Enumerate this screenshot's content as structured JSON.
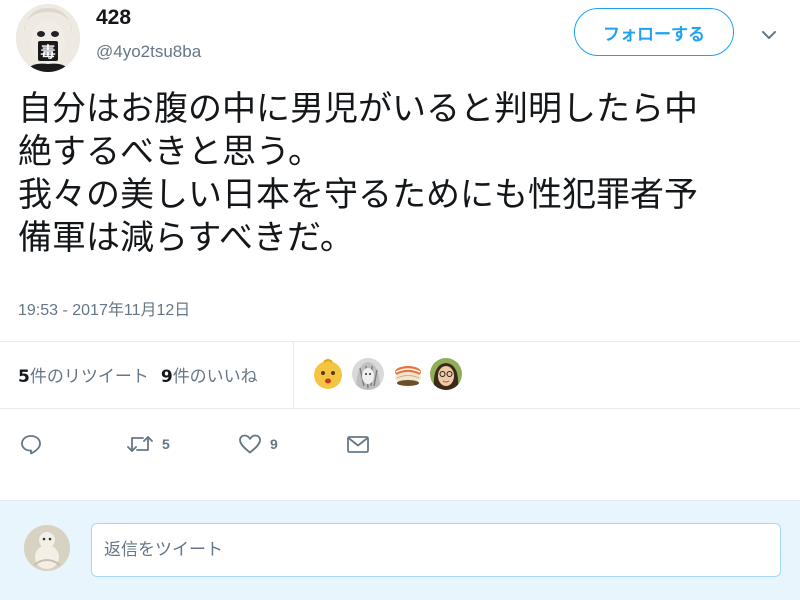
{
  "user": {
    "name": "428",
    "handle": "@4yo2tsu8ba",
    "avatar_glyph": "毒"
  },
  "follow_button": {
    "label": "フォローする"
  },
  "tweet": {
    "lines": [
      "自分はお腹の中に男児がいると判明したら中",
      "絶するべきと思う。",
      "我々の美しい日本を守るためにも性犯罪者予",
      "備軍は減らすべきだ。"
    ],
    "timestamp": "19:53 - 2017年11月12日"
  },
  "stats": {
    "retweets": {
      "count": "5",
      "label": "件のリツイート"
    },
    "likes": {
      "count": "9",
      "label": "件のいいね"
    }
  },
  "actions": {
    "reply_icon": "reply-icon",
    "retweet_icon": "retweet-icon",
    "retweet_count": "5",
    "like_icon": "heart-icon",
    "like_count": "9",
    "dm_icon": "envelope-icon"
  },
  "reply_box": {
    "placeholder": "返信をツイート"
  },
  "colors": {
    "accent": "#1da1f2",
    "secondary_text": "#657786",
    "divider": "#e6ecf0",
    "reply_background": "#e8f5fd"
  }
}
